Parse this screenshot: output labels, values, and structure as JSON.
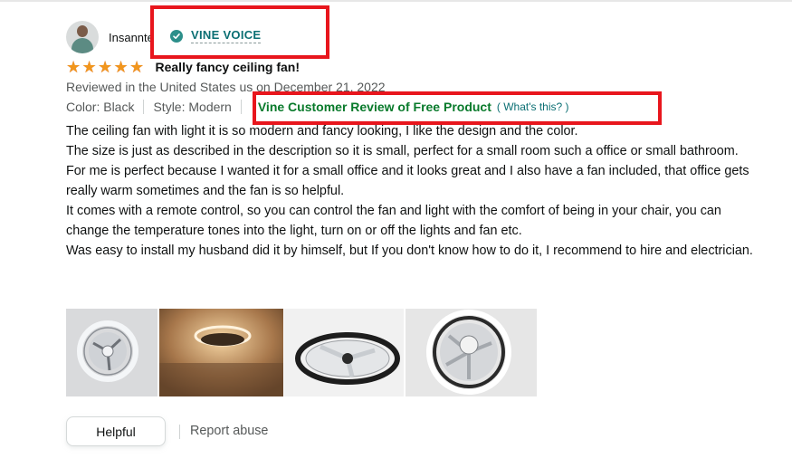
{
  "reviewer": {
    "name": "Insannte",
    "badge": "VINE VOICE"
  },
  "review": {
    "rating_stars": 5,
    "title": "Really fancy ceiling fan!",
    "date_line": "Reviewed in the United States us on December 21, 2022",
    "color": "Color: Black",
    "style": "Style: Modern",
    "vine_label": "Vine Customer Review of Free Product",
    "whats_this_open": "(",
    "whats_this": "What's this?",
    "whats_this_close": ")",
    "body": [
      "The ceiling fan with light it is so modern and fancy looking, I like the design and the color.",
      "The size is just as described in the description so it is small, perfect for a small room such a office or small bathroom.",
      "For me is perfect because I wanted it for a small office and it looks great and I also have a fan included, that office gets really warm sometimes and the fan is so helpful.",
      "It comes with a remote control, so you can control the fan and light with the comfort of being in your chair, you can change the temperature tones into the light, turn on or off the lights and fan etc.",
      "Was easy to install my husband did it by himself, but If you don't know how to do it, I recommend to hire and electrician."
    ]
  },
  "actions": {
    "helpful": "Helpful",
    "report": "Report abuse"
  },
  "colors": {
    "star": "#f1961d",
    "vine_badge": "#0b6f73",
    "vine_label": "#087a2b",
    "highlight_box": "#e8161d",
    "secondary_text": "#565959"
  },
  "icons": {
    "verified": "check-badge-icon",
    "star": "star-icon"
  }
}
